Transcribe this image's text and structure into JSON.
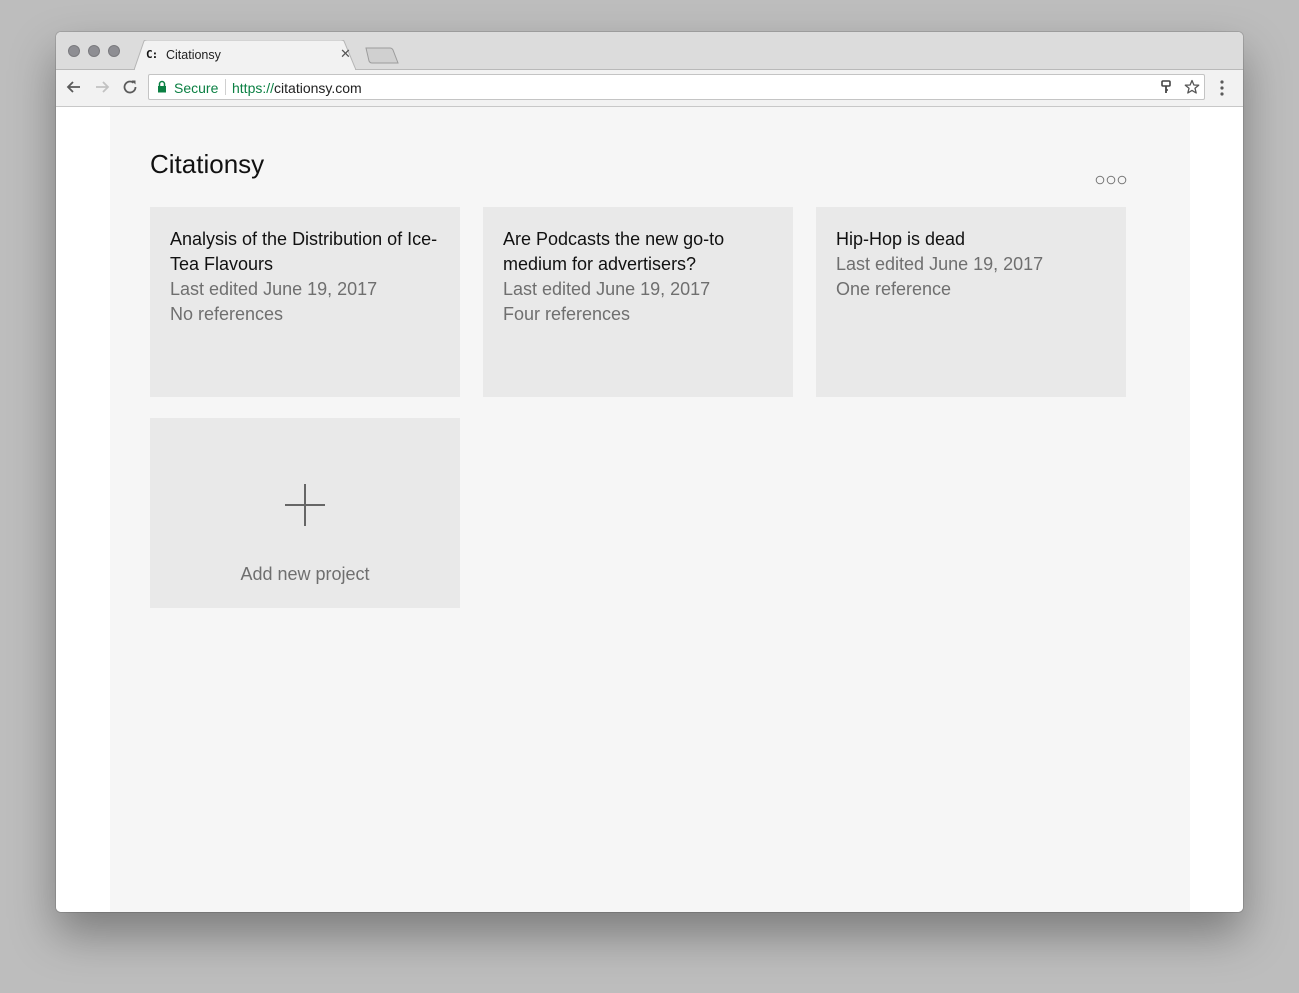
{
  "browser": {
    "tab_title": "Citationsy",
    "tab_favicon": "C:",
    "secure_label": "Secure",
    "url_scheme": "https://",
    "url_host": "citationsy.com"
  },
  "app": {
    "title": "Citationsy"
  },
  "projects": [
    {
      "title": "Analysis of the Distribution of Ice-Tea Flavours",
      "edited": "Last edited June 19, 2017",
      "references": "No references"
    },
    {
      "title": "Are Podcasts the new go-to medium for advertisers?",
      "edited": "Last edited June 19, 2017",
      "references": "Four references"
    },
    {
      "title": "Hip-Hop is dead",
      "edited": "Last edited June 19, 2017",
      "references": "One reference"
    }
  ],
  "add_project": {
    "label": "Add new project"
  },
  "colors": {
    "secure_green": "#0b8043",
    "card_background": "#e9e9e9",
    "content_background": "#f6f6f6"
  },
  "icons": [
    "back-arrow-icon",
    "forward-arrow-icon",
    "reload-icon",
    "lock-icon",
    "key-icon",
    "star-icon",
    "menu-dots-icon",
    "more-dots-icon",
    "plus-icon",
    "close-icon"
  ]
}
